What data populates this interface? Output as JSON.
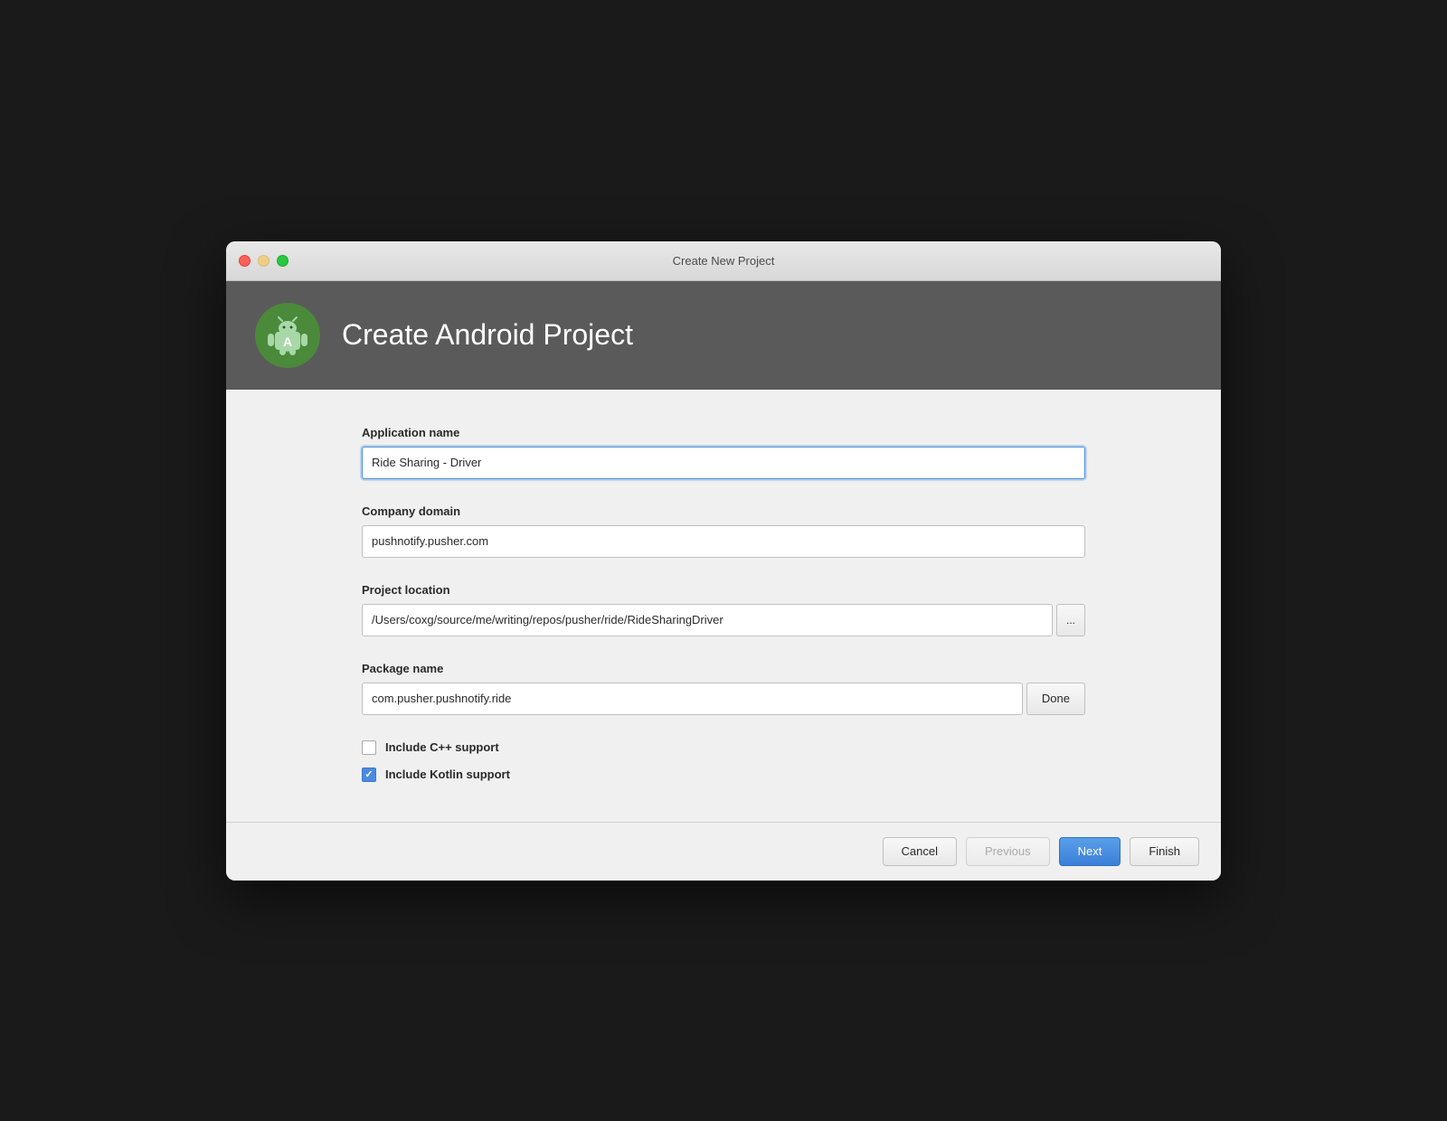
{
  "window": {
    "title": "Create New Project",
    "traffic_lights": {
      "close": "close",
      "minimize": "minimize",
      "maximize": "maximize"
    }
  },
  "header": {
    "logo_alt": "android-studio-logo",
    "title": "Create Android Project"
  },
  "form": {
    "app_name_label": "Application name",
    "app_name_value": "Ride Sharing - Driver",
    "app_name_placeholder": "Application name",
    "company_domain_label": "Company domain",
    "company_domain_value": "pushnotify.pusher.com",
    "project_location_label": "Project location",
    "project_location_value": "/Users/coxg/source/me/writing/repos/pusher/ride/RideSharingDriver",
    "browse_button_label": "...",
    "package_name_label": "Package name",
    "package_name_value": "com.pusher.pushnotify.ride",
    "done_button_label": "Done",
    "cpp_support_label": "Include C++ support",
    "cpp_support_checked": false,
    "kotlin_support_label": "Include Kotlin support",
    "kotlin_support_checked": true
  },
  "footer": {
    "cancel_label": "Cancel",
    "previous_label": "Previous",
    "next_label": "Next",
    "finish_label": "Finish"
  }
}
